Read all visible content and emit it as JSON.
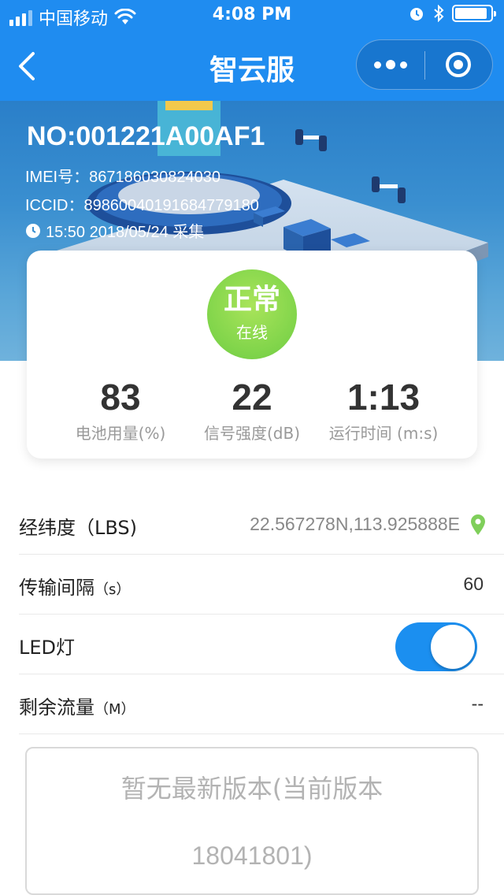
{
  "status_bar": {
    "carrier": "中国移动",
    "time": "4:08 PM",
    "battery_level": 0.9
  },
  "nav": {
    "title": "智云服"
  },
  "device": {
    "number": "NO:001221A00AF1",
    "imei": "IMEI号：867186030824030",
    "iccid": "ICCID：89860040191684779180",
    "collected_at": "15:50 2018/05/24 采集"
  },
  "status": {
    "main": "正常",
    "sub": "在线",
    "color": "#7fd44a"
  },
  "stats": [
    {
      "value": "83",
      "label": "电池用量(%)"
    },
    {
      "value": "22",
      "label": "信号强度(dB)"
    },
    {
      "value": "1:13",
      "label": "运行时间 (m:s)"
    }
  ],
  "rows": {
    "location": {
      "label": "经纬度（LBS)",
      "value": "22.567278N,113.925888E"
    },
    "interval": {
      "label": "传输间隔",
      "unit": "（s）",
      "value": "60"
    },
    "led": {
      "label": "LED灯",
      "on": true
    },
    "traffic": {
      "label": "剩余流量",
      "unit": "（M）",
      "value": "--"
    }
  },
  "version": {
    "line1": "暂无最新版本(当前版本",
    "line2": "18041801)"
  },
  "colors": {
    "accent": "#1f8cf0",
    "toggle_on": "#1b8ff0",
    "pin": "#7fcf5a"
  }
}
